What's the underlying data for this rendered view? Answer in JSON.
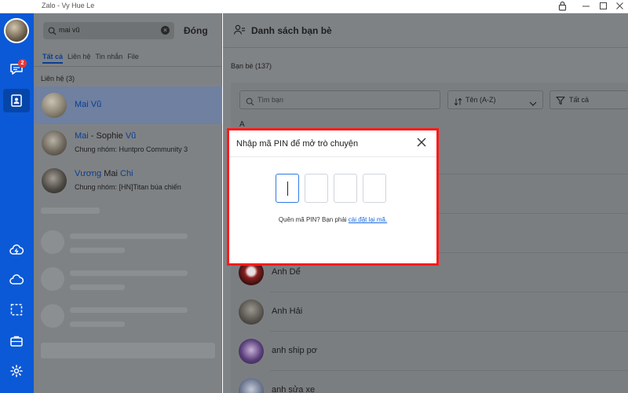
{
  "window": {
    "title": "Zalo - Vy Hue Le"
  },
  "titlebar": {
    "lock_icon": "lock-icon",
    "minimize_icon": "minimize-icon",
    "maximize_icon": "maximize-icon",
    "close_icon": "close-icon"
  },
  "rail": {
    "messages_badge": "2"
  },
  "search": {
    "value": "mai vũ",
    "close_label": "Đóng"
  },
  "tabs": [
    {
      "label": "Tất cả"
    },
    {
      "label": "Liên hệ"
    },
    {
      "label": "Tin nhắn"
    },
    {
      "label": "File"
    }
  ],
  "contacts_section": {
    "label": "Liên hệ (3)"
  },
  "contacts": [
    {
      "name": "Mai Vũ",
      "subtitle": ""
    },
    {
      "name_pre": "Mai",
      "name_mid": " - Sophie ",
      "name_post": "Vũ",
      "subtitle": "Chung nhóm: Huntpro Community 3"
    },
    {
      "name_pre": "Vương ",
      "name_mid": "Mai",
      "name_post": " Chi",
      "subtitle": "Chung nhóm: [HN]Titan búa chiến"
    }
  ],
  "right_header": {
    "title": "Danh sách bạn bè"
  },
  "friends": {
    "count_label": "Bạn bè (137)",
    "search_placeholder": "Tìm bạn",
    "sort_label": "Tên (A-Z)",
    "filter_label": "Tất cả",
    "letter": "A",
    "items": [
      {
        "name": "Anh Dể"
      },
      {
        "name": "Anh Hải"
      },
      {
        "name": "anh ship pơ"
      },
      {
        "name": "anh sửa xe"
      }
    ]
  },
  "pin_dialog": {
    "title": "Nhập mã PIN để mở trò chuyện",
    "hint": "Quên mã PIN? Bạn phải ",
    "reset_link": "cài đặt lại mã."
  },
  "colors": {
    "accent": "#0b59d6",
    "highlight": "#ff1a1a",
    "link": "#1a6ae0"
  }
}
